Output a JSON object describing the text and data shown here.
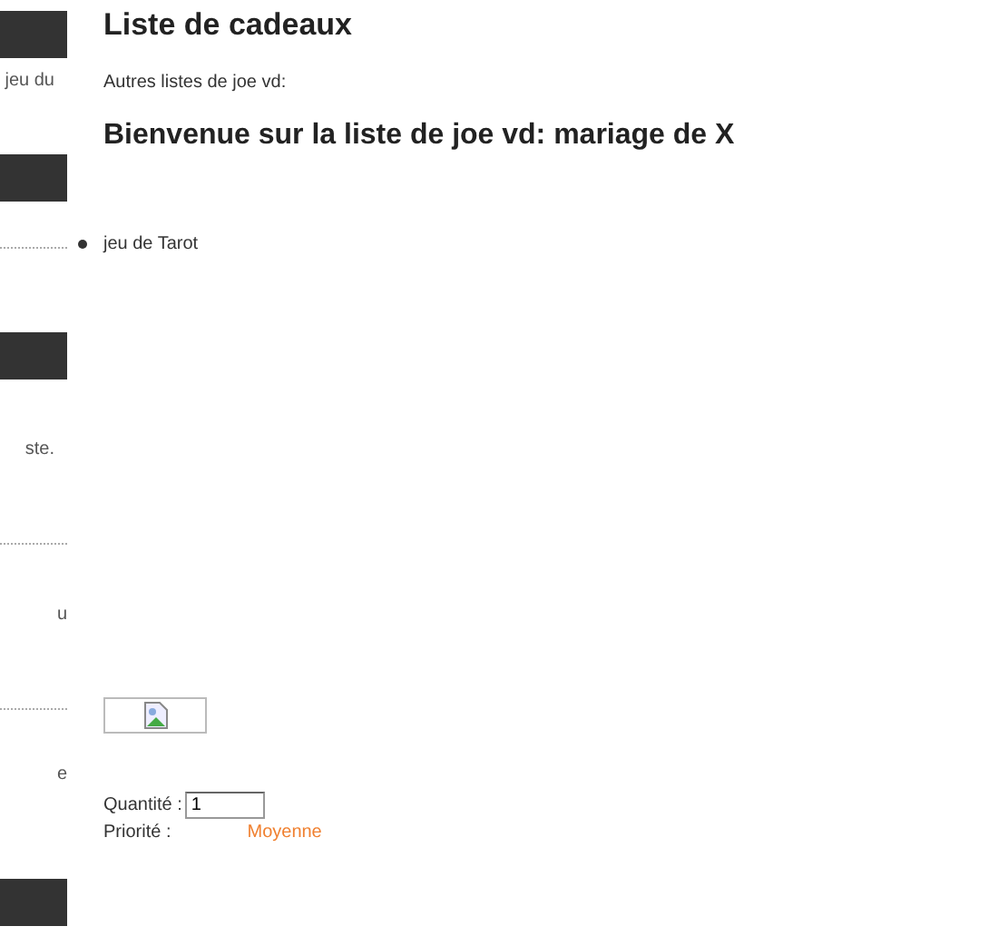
{
  "sidebar": {
    "items": [
      {
        "kind": "bar"
      },
      {
        "kind": "text",
        "text": "jeu du"
      },
      {
        "kind": "bar"
      },
      {
        "kind": "divider"
      },
      {
        "kind": "bar"
      },
      {
        "kind": "text",
        "text": "ste."
      },
      {
        "kind": "divider"
      },
      {
        "kind": "text",
        "text": "u"
      },
      {
        "kind": "divider"
      },
      {
        "kind": "text",
        "text": "e"
      },
      {
        "kind": "bar"
      }
    ]
  },
  "main": {
    "title": "Liste de cadeaux",
    "other_lists": "Autres listes de joe vd:",
    "welcome": "Bienvenue sur la liste de joe vd: mariage de X",
    "items": [
      "jeu de Tarot"
    ],
    "gift": {
      "image": {
        "kind": "broken-image"
      },
      "quantity_label": "Quantité :",
      "quantity_value": "1",
      "priority_label": "Priorité :",
      "priority_value": "Moyenne"
    }
  }
}
